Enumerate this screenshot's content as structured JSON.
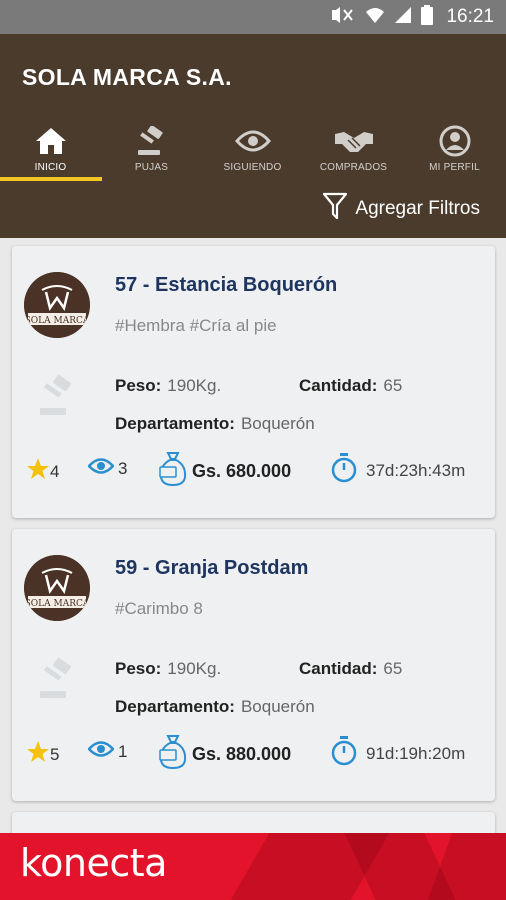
{
  "status_bar": {
    "time": "16:21",
    "colors": {
      "bg": "#7a7a7a"
    }
  },
  "header": {
    "title": "SOLA MARCA S.A.",
    "bg_color": "#4a3b2d",
    "accent_color": "#f3c623",
    "tabs": [
      {
        "label": "INICIO",
        "icon": "home-icon",
        "active": true
      },
      {
        "label": "PUJAS",
        "icon": "gavel-icon",
        "active": false
      },
      {
        "label": "SIGUIENDO",
        "icon": "eye-icon",
        "active": false
      },
      {
        "label": "COMPRADOS",
        "icon": "handshake-icon",
        "active": false
      },
      {
        "label": "MI PERFIL",
        "icon": "user-icon",
        "active": false
      }
    ],
    "filter_label": "Agregar Filtros"
  },
  "cards": [
    {
      "title": "57 - Estancia Boquerón",
      "tags": "#Hembra #Cría al pie",
      "peso_label": "Peso:",
      "peso_value": "190Kg.",
      "cantidad_label": "Cantidad:",
      "cantidad_value": "65",
      "departamento_label": "Departamento:",
      "departamento_value": "Boquerón",
      "stars": "4",
      "views": "3",
      "price": "Gs. 680.000",
      "time_left": "37d:23h:43m"
    },
    {
      "title": "59 - Granja Postdam",
      "tags": "#Carimbo 8",
      "peso_label": "Peso:",
      "peso_value": "190Kg.",
      "cantidad_label": "Cantidad:",
      "cantidad_value": "65",
      "departamento_label": "Departamento:",
      "departamento_value": "Boquerón",
      "stars": "5",
      "views": "1",
      "price": "Gs. 880.000",
      "time_left": "91d:19h:20m"
    }
  ],
  "avatar_logo_text": "SOLA MARCA",
  "banner": {
    "brand": "konecta",
    "color": "#e3132b"
  }
}
